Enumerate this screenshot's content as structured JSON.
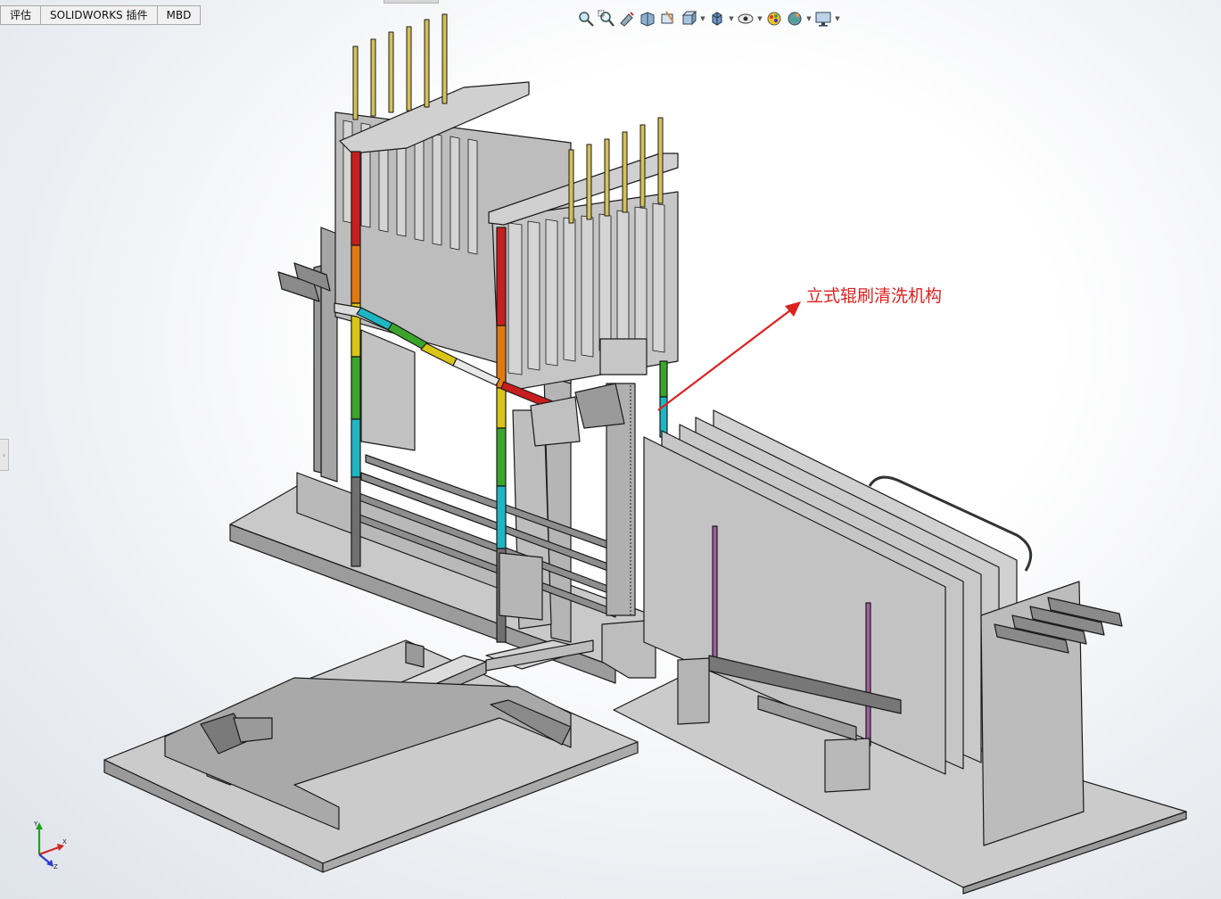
{
  "tabs": [
    "评估",
    "SOLIDWORKS 插件",
    "MBD"
  ],
  "heads_up_toolbar": [
    {
      "icon": "zoom-to-fit-icon",
      "dropdown": false
    },
    {
      "icon": "zoom-to-area-icon",
      "dropdown": false
    },
    {
      "icon": "previous-view-icon",
      "dropdown": false
    },
    {
      "icon": "section-view-icon",
      "dropdown": false
    },
    {
      "icon": "dynamic-annotation-view-icon",
      "dropdown": false
    },
    {
      "icon": "view-orientation-icon",
      "dropdown": true
    },
    {
      "icon": "display-style-icon",
      "dropdown": true
    },
    {
      "icon": "hide-show-items-icon",
      "dropdown": true
    },
    {
      "icon": "edit-appearance-icon",
      "dropdown": false
    },
    {
      "icon": "apply-scene-icon",
      "dropdown": true
    },
    {
      "icon": "view-settings-icon",
      "dropdown": true
    }
  ],
  "annotation": {
    "label": "立式辊刷清洗机构",
    "color": "#e02020"
  },
  "triad": {
    "x": "X",
    "y": "Y",
    "z": "Z"
  },
  "colors": {
    "accent": "#e02020",
    "model_grey": "#c8c8c8",
    "edge": "#1a1a1a"
  }
}
